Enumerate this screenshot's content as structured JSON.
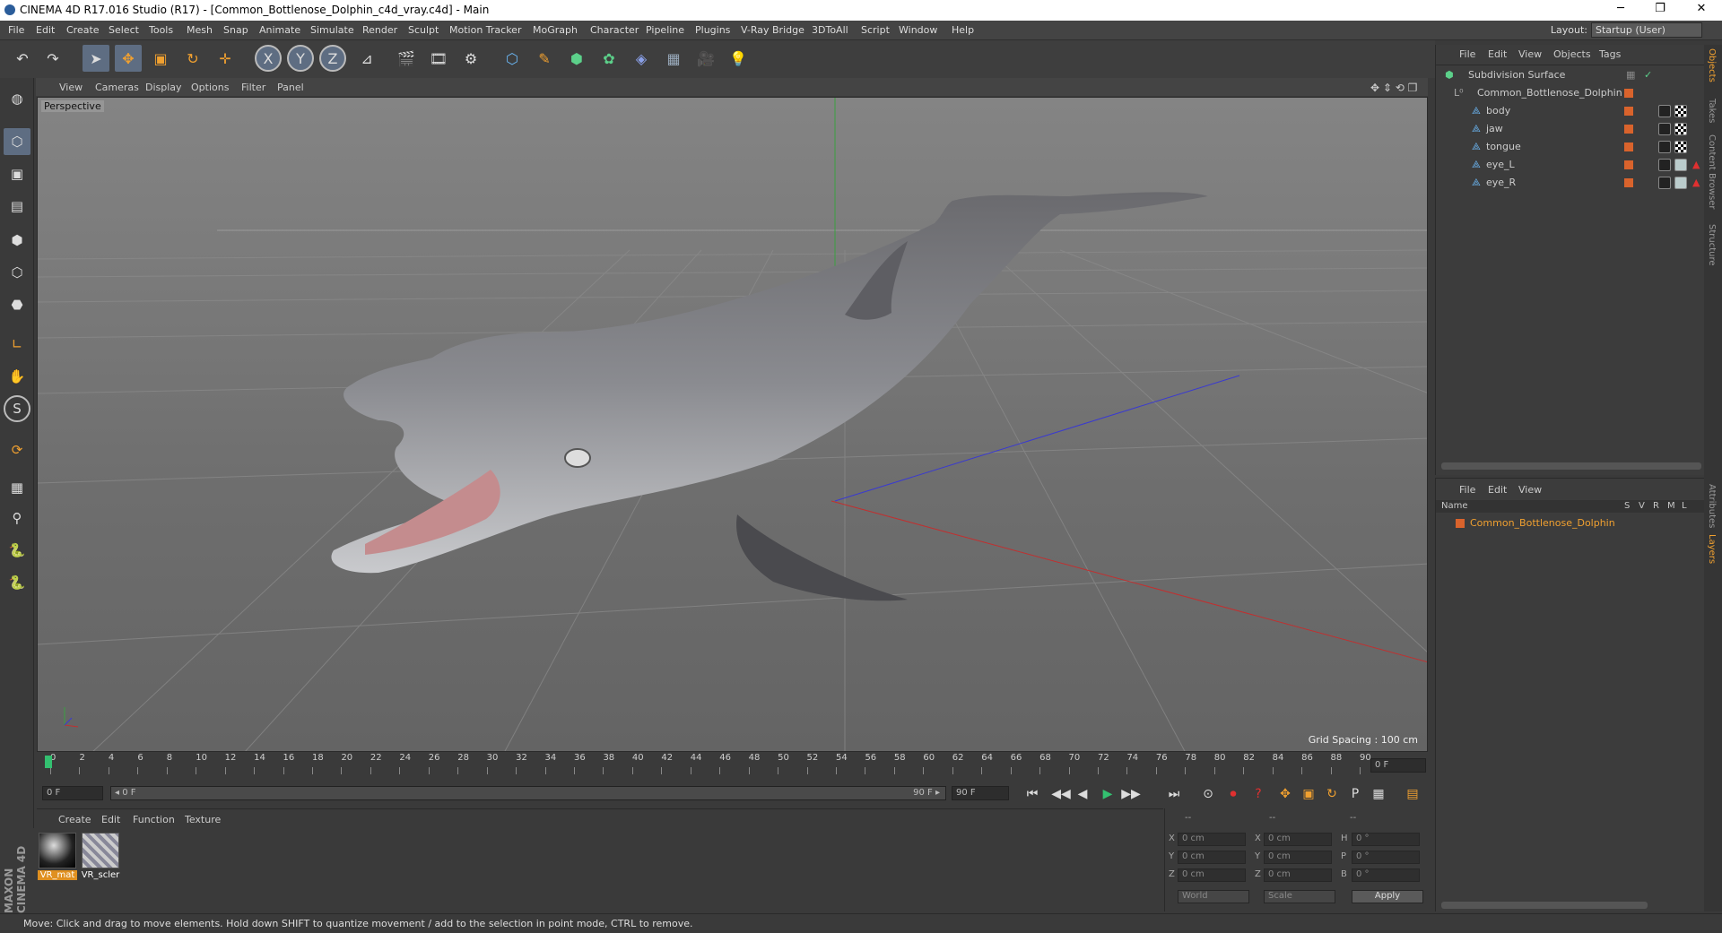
{
  "window": {
    "title": "CINEMA 4D R17.016 Studio (R17) - [Common_Bottlenose_Dolphin_c4d_vray.c4d] - Main",
    "min": "─",
    "restore": "❐",
    "close": "✕"
  },
  "menu": [
    "File",
    "Edit",
    "Create",
    "Select",
    "Tools",
    "Mesh",
    "Snap",
    "Animate",
    "Simulate",
    "Render",
    "Sculpt",
    "Motion Tracker",
    "MoGraph",
    "Character",
    "Pipeline",
    "Plugins",
    "V-Ray Bridge",
    "3DToAll",
    "Script",
    "Window",
    "Help"
  ],
  "layout": {
    "label": "Layout:",
    "value": "Startup (User)"
  },
  "toolbar": {
    "undo": "↶",
    "redo": "↷",
    "select": "➤",
    "move": "✥",
    "scale": "▣",
    "rotate": "↻",
    "move2": "✛",
    "x": "X",
    "y": "Y",
    "z": "Z",
    "coord": "⊿",
    "render_view": "🎬",
    "render_region": "🎞",
    "render_settings": "⚙",
    "cube": "⬡",
    "pen": "✎",
    "nurbs": "⬢",
    "array": "✿",
    "deformer": "◈",
    "floor": "▦",
    "camera": "🎥",
    "light": "💡"
  },
  "left_tools": [
    "◍",
    "⬡",
    "▣",
    "▤",
    "⬢",
    "⬡",
    "⬣",
    "∟",
    "✋",
    "S",
    "⟳",
    "▦",
    "⚲",
    "🐍",
    "🐍"
  ],
  "viewport": {
    "menu": [
      "View",
      "Cameras",
      "Display",
      "Options",
      "Filter",
      "Panel"
    ],
    "label": "Perspective",
    "grid_spacing": "Grid Spacing : 100 cm"
  },
  "timeline": {
    "ticks": [
      "0",
      "2",
      "4",
      "6",
      "8",
      "10",
      "12",
      "14",
      "16",
      "18",
      "20",
      "22",
      "24",
      "26",
      "28",
      "30",
      "32",
      "34",
      "36",
      "38",
      "40",
      "42",
      "44",
      "46",
      "48",
      "50",
      "52",
      "54",
      "56",
      "58",
      "60",
      "62",
      "64",
      "66",
      "68",
      "70",
      "72",
      "74",
      "76",
      "78",
      "80",
      "82",
      "84",
      "86",
      "88",
      "90"
    ],
    "current_frame": "0 F"
  },
  "playback": {
    "start": "0 F",
    "range_start": "◂ 0 F",
    "range_end": "90 F ▸",
    "end": "90 F",
    "buttons": [
      "⏮",
      "◀◀",
      "◀",
      "▶",
      "▶▶",
      "⏭"
    ],
    "extra": [
      "⊙",
      "⏺",
      "?",
      "✥",
      "▣",
      "↻",
      "P",
      "▦",
      "▤"
    ]
  },
  "materials": {
    "menu": [
      "Create",
      "Edit",
      "Function",
      "Texture"
    ],
    "items": [
      "VR_mat",
      "VR_scler"
    ],
    "brand": "MAXON CINEMA 4D"
  },
  "coords": {
    "headers": [
      "--",
      "--",
      "--"
    ],
    "rows": [
      {
        "a": "X",
        "av": "0 cm",
        "b": "X",
        "bv": "0 cm",
        "c": "H",
        "cv": "0 °"
      },
      {
        "a": "Y",
        "av": "0 cm",
        "b": "Y",
        "bv": "0 cm",
        "c": "P",
        "cv": "0 °"
      },
      {
        "a": "Z",
        "av": "0 cm",
        "b": "Z",
        "bv": "0 cm",
        "c": "B",
        "cv": "0 °"
      }
    ],
    "mode1": "World",
    "mode2": "Scale",
    "apply": "Apply"
  },
  "status": "Move: Click and drag to move elements. Hold down SHIFT to quantize movement / add to the selection in point mode, CTRL to remove.",
  "object_manager": {
    "menu": [
      "File",
      "Edit",
      "View",
      "Objects",
      "Tags"
    ],
    "rows": [
      {
        "name": "Subdivision Surface",
        "indent": 0
      },
      {
        "name": "Common_Bottlenose_Dolphin",
        "indent": 1
      },
      {
        "name": "body",
        "indent": 2
      },
      {
        "name": "jaw",
        "indent": 2
      },
      {
        "name": "tongue",
        "indent": 2
      },
      {
        "name": "eye_L",
        "indent": 2
      },
      {
        "name": "eye_R",
        "indent": 2
      }
    ]
  },
  "layer_manager": {
    "menu": [
      "File",
      "Edit",
      "View"
    ],
    "columns": [
      "Name",
      "S",
      "V",
      "R",
      "M",
      "L"
    ],
    "row": "Common_Bottlenose_Dolphin"
  },
  "right_tabs": [
    "Objects",
    "Takes",
    "Content Browser",
    "Structure",
    "Attributes",
    "Layers"
  ],
  "colors": {
    "accent": "#d9632c",
    "selected": "#5e6d82",
    "layer_text": "#f0a030"
  }
}
